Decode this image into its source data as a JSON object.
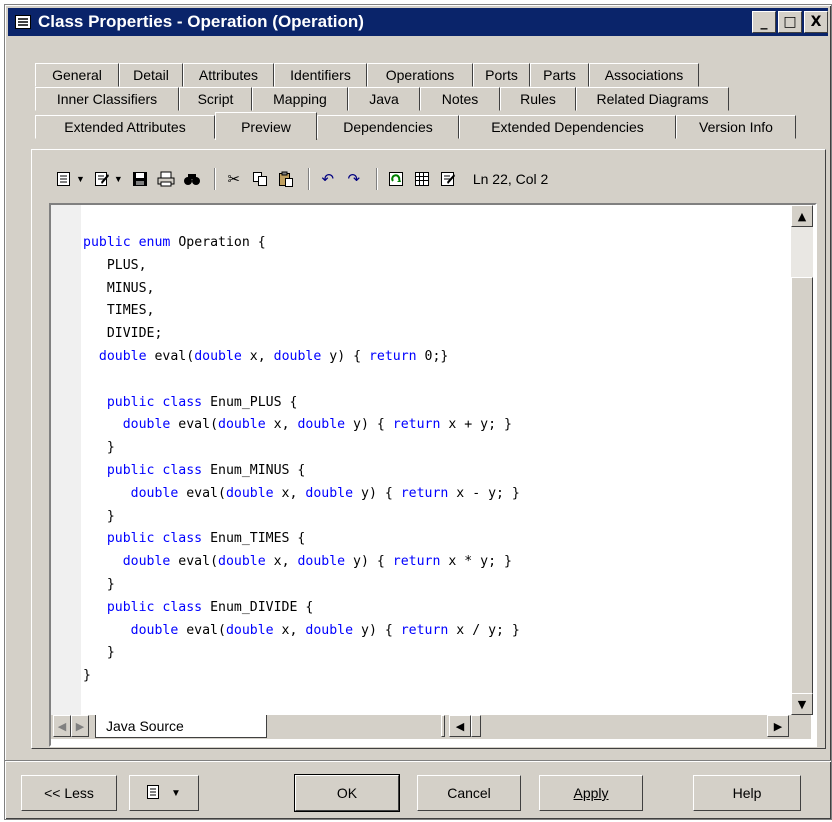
{
  "window": {
    "title": "Class Properties - Operation (Operation)",
    "icon": "properties-window-icon",
    "minimize": "_",
    "maximize": "□",
    "close": "X"
  },
  "tabs": {
    "row1": [
      "General",
      "Detail",
      "Attributes",
      "Identifiers",
      "Operations",
      "Ports",
      "Parts",
      "Associations"
    ],
    "row2": [
      "Inner Classifiers",
      "Script",
      "Mapping",
      "Java",
      "Notes",
      "Rules",
      "Related Diagrams"
    ],
    "row3": [
      "Extended Attributes",
      "Preview",
      "Dependencies",
      "Extended Dependencies",
      "Version Info"
    ],
    "active": "Preview"
  },
  "toolbar": {
    "icons": [
      "preview-options-icon",
      "edit-icon",
      "save-icon",
      "print-icon",
      "find-icon",
      "cut-icon",
      "copy-icon",
      "paste-icon",
      "undo-icon",
      "redo-icon",
      "refresh-icon",
      "grid-icon",
      "edit-script-icon"
    ],
    "status": "Ln 22, Col 2"
  },
  "code": {
    "lines": [
      "public enum Operation {",
      "   PLUS,",
      "   MINUS,",
      "   TIMES,",
      "   DIVIDE;",
      "  double eval(double x, double y) { return 0;}",
      "",
      "   public class Enum_PLUS {",
      "     double eval(double x, double y) { return x + y; }",
      "   }",
      "   public class Enum_MINUS {",
      "      double eval(double x, double y) { return x - y; }",
      "   }",
      "   public class Enum_TIMES {",
      "     double eval(double x, double y) { return x * y; }",
      "   }",
      "   public class Enum_DIVIDE {",
      "      double eval(double x, double y) { return x / y; }",
      "   }",
      "}"
    ],
    "keywords": [
      "public",
      "enum",
      "class",
      "double",
      "return"
    ],
    "keyword_color": "#0000ff"
  },
  "editor_tabs": {
    "source_tab": "Java Source"
  },
  "buttons": {
    "less": "<< Less",
    "ok": "OK",
    "cancel": "Cancel",
    "apply": "Apply",
    "help": "Help"
  },
  "colors": {
    "titlebar": "#0a246a",
    "face": "#d4d0c8"
  }
}
